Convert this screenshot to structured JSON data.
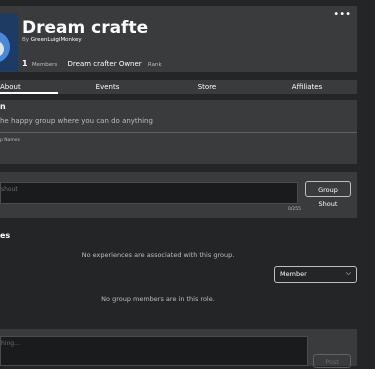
{
  "group": {
    "name": "Dream crafte",
    "by_prefix": "By ",
    "owner": "GreenLuigiMonkey",
    "member_count": "1",
    "member_label": "Members",
    "rank_name": "Dream crafter Owner",
    "rank_label": "Rank",
    "menu": "•••"
  },
  "tabs": [
    {
      "label": "About",
      "active": true
    },
    {
      "label": "Events",
      "active": false
    },
    {
      "label": "Store",
      "active": false
    },
    {
      "label": "Affiliates",
      "active": false
    }
  ],
  "about": {
    "heading": "n",
    "description": "he happy group where you can do anything",
    "tag": "p Names"
  },
  "shout": {
    "placeholder": "shout",
    "button_label": "Group Shout",
    "char_count": "0/255"
  },
  "games": {
    "heading": "es",
    "empty_message": "No experiences are associated with this group."
  },
  "members": {
    "role_selected": "Member",
    "empty_message": "No group members are in this role."
  },
  "wall": {
    "placeholder": "hing...",
    "post_label": "Post"
  },
  "icons": {
    "menu": "more-options-icon",
    "select": "chevron-down-icon"
  },
  "colors": {
    "background": "#232527",
    "panel": "#393b3d",
    "text_primary": "#ffffff",
    "text_secondary": "#bdbebe"
  }
}
